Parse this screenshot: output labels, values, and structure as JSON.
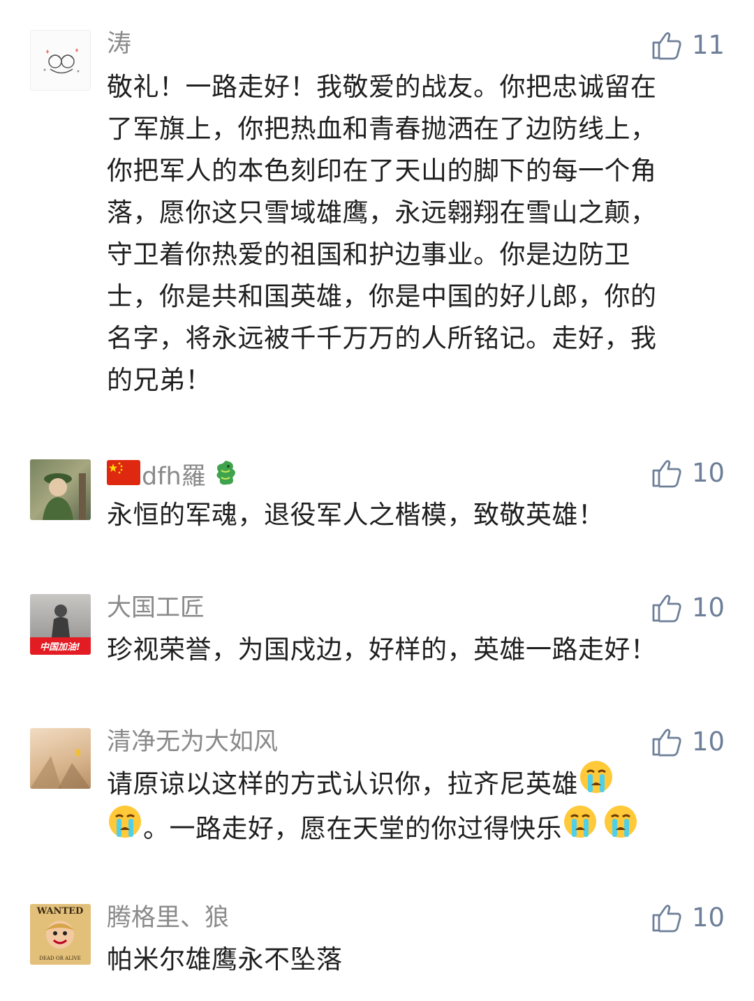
{
  "comments": [
    {
      "username": "涛",
      "likes": "11",
      "text_lines": [
        "敬礼！一路走好！我敬爱的战友。你把忠诚留在",
        "了军旗上，你把热血和青春抛洒在了边防线上，",
        "你把军人的本色刻印在了天山的脚下的每一个角",
        "落，愿你这只雪域雄鹰，永远翱翔在雪山之颠，",
        "守卫着你热爱的祖国和护边事业。你是边防卫",
        "士，你是共和国英雄，你是中国的好儿郎，你的",
        "名字，将永远被千千万万的人所铭记。走好，我",
        "的兄弟！"
      ]
    },
    {
      "username": "dfh羅",
      "likes": "10",
      "text_lines": [
        "永恒的军魂，退役军人之楷模，致敬英雄！"
      ]
    },
    {
      "username": "大国工匠",
      "likes": "10",
      "avatar_caption": "中国加油!",
      "text_lines": [
        "珍视荣誉，为国戍边，好样的，英雄一路走好！"
      ]
    },
    {
      "username": "清净无为大如风",
      "likes": "10",
      "text_line1": "请原谅以这样的方式认识你，拉齐尼英雄",
      "text_line2": "。一路走好，愿在天堂的你过得快乐"
    },
    {
      "username": "腾格里、狼",
      "likes": "10",
      "avatar_top": "WANTED",
      "avatar_bottom": "DEAD OR ALIVE",
      "text_lines": [
        "帕米尔雄鹰永不坠落"
      ]
    }
  ],
  "colors": {
    "username": "#8a8a8a",
    "like": "#6d7f98",
    "text": "#1f1f1f",
    "background": "#ffffff"
  },
  "icons": {
    "like": "thumbs-up-icon",
    "crying": "crying-face-icon",
    "flag": "china-flag-icon",
    "dragon": "dragon-icon"
  }
}
